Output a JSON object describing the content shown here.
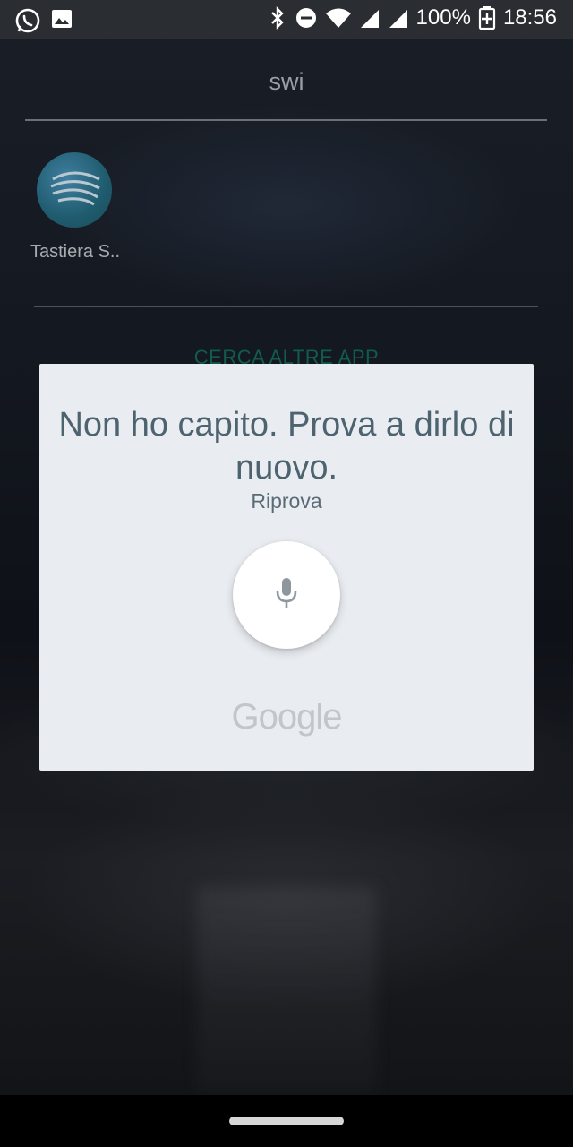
{
  "status_bar": {
    "battery": "100%",
    "time": "18:56",
    "icons_left": [
      "whatsapp-icon",
      "image-icon"
    ],
    "icons_right": [
      "bluetooth-icon",
      "dnd-icon",
      "wifi-icon",
      "signal-icon",
      "signal-icon-2",
      "battery-icon"
    ]
  },
  "search": {
    "query": "swi"
  },
  "results": {
    "apps": [
      {
        "label": "Tastiera S..",
        "icon": "swiftkey-app-icon"
      }
    ],
    "more_apps_label": "CERCA ALTRE APP"
  },
  "dialog": {
    "title": "Non ho capito. Prova a dirlo di nuovo.",
    "retry_label": "Riprova",
    "mic_icon": "microphone-icon",
    "brand": "Google"
  },
  "colors": {
    "dialog_bg": "#e9edf1",
    "title_text": "#4d6370",
    "accent_green": "#115c4a"
  }
}
